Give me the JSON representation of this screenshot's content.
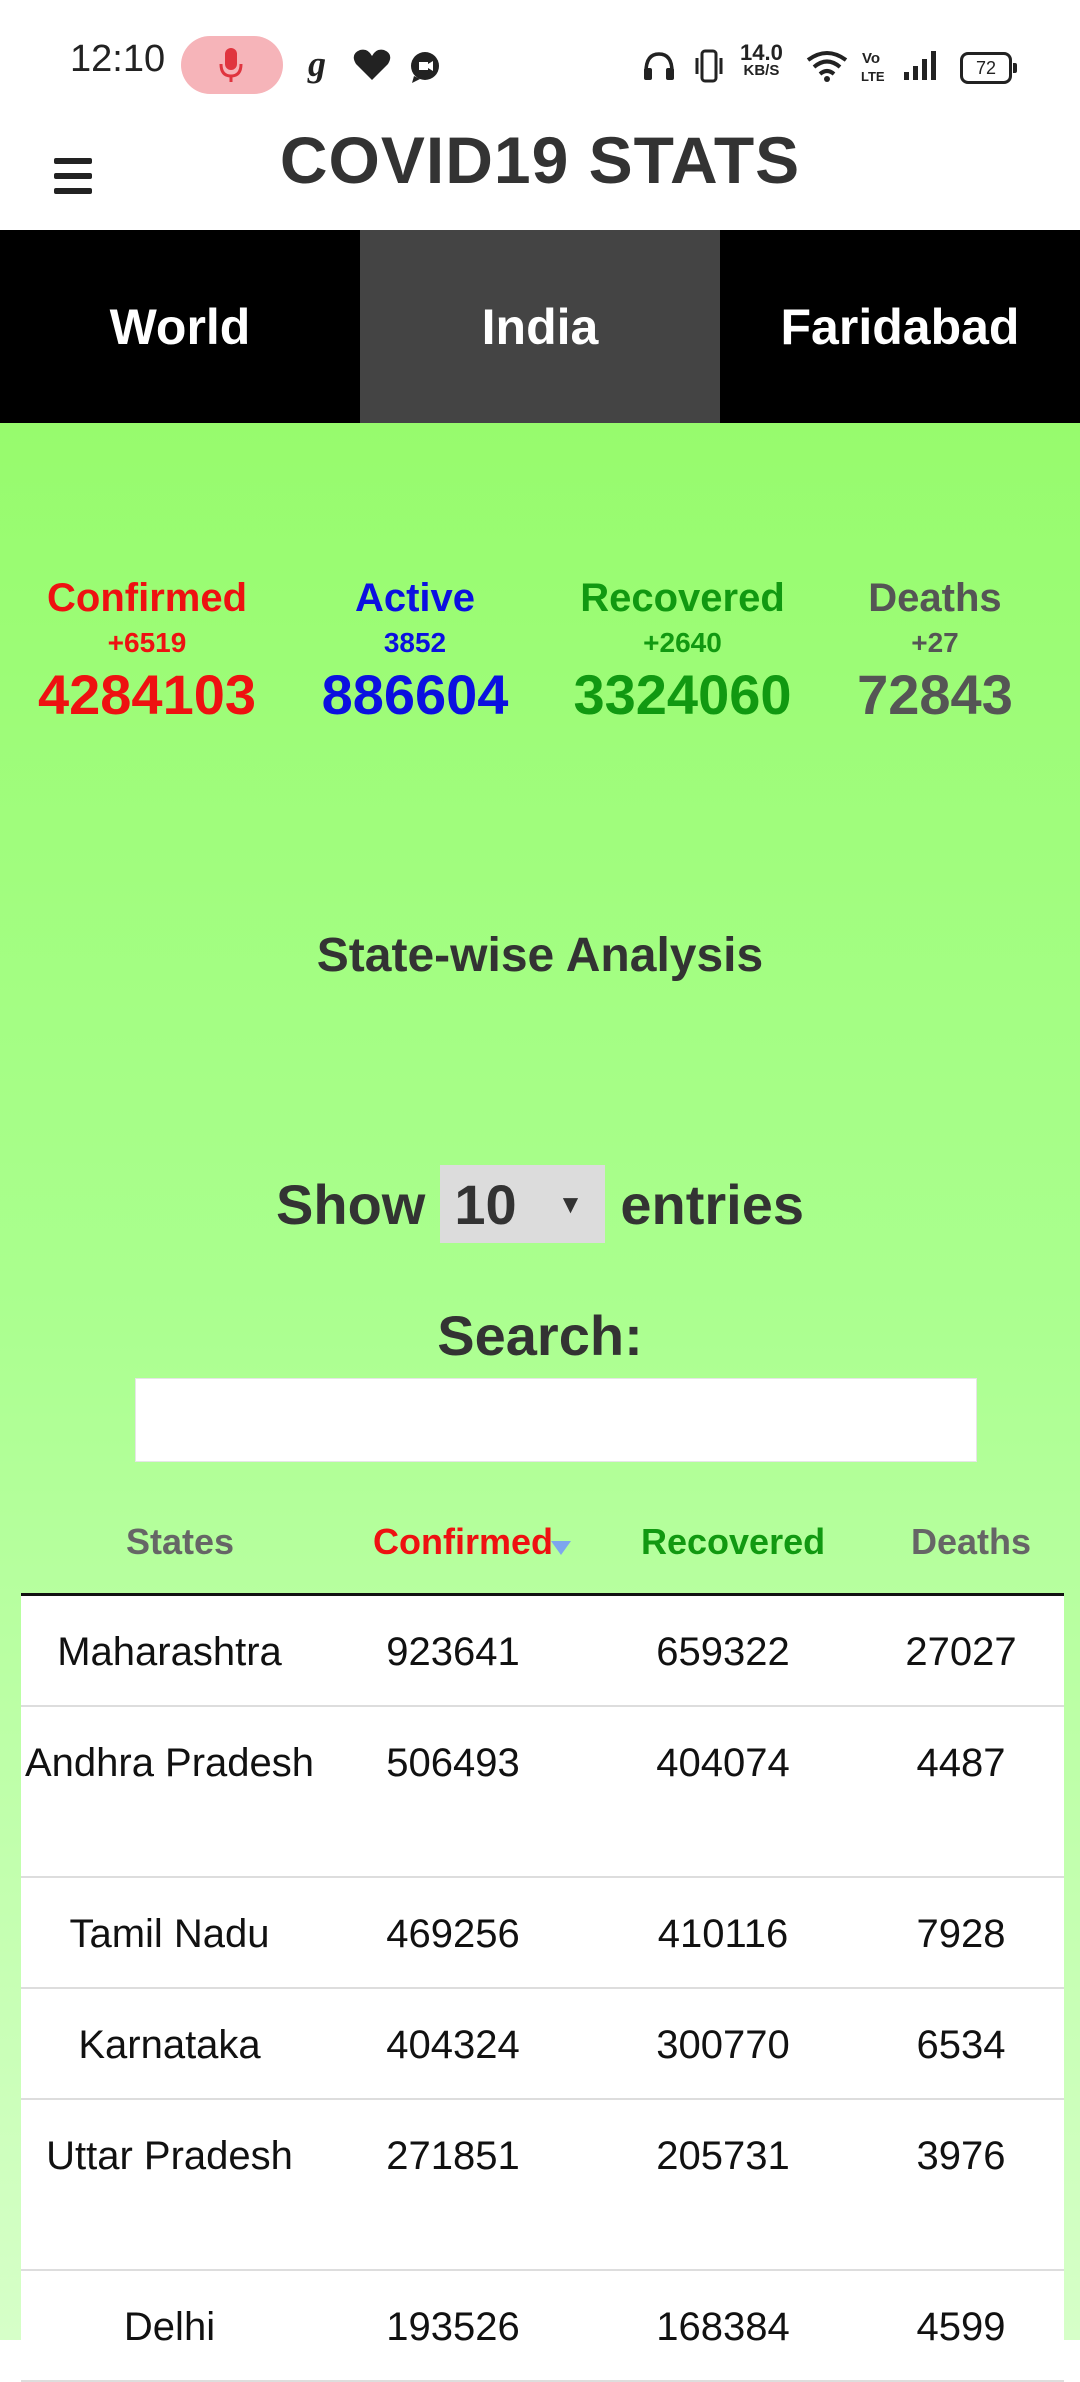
{
  "status_bar": {
    "time": "12:10",
    "speed_value": "14.0",
    "speed_unit": "KB/S",
    "battery": "72",
    "icons": [
      "mic-icon",
      "g-app-icon",
      "heart-icon",
      "chat-icon",
      "headphones-icon",
      "vibrate-icon",
      "wifi-icon",
      "volte-icon",
      "signal-icon",
      "battery-icon"
    ]
  },
  "header": {
    "title": "COVID19 STATS",
    "menu_icon": "hamburger-menu-icon"
  },
  "tabs": [
    {
      "label": "World",
      "active": false
    },
    {
      "label": "India",
      "active": true
    },
    {
      "label": "Faridabad",
      "active": false
    }
  ],
  "summary": [
    {
      "label": "Confirmed",
      "delta": "+6519",
      "value": "4284103",
      "color": "#ee1111"
    },
    {
      "label": "Active",
      "delta": "3852",
      "value": "886604",
      "color": "#0b10e0"
    },
    {
      "label": "Recovered",
      "delta": "+2640",
      "value": "3324060",
      "color": "#119911"
    },
    {
      "label": "Deaths",
      "delta": "+27",
      "value": "72843",
      "color": "#555555"
    }
  ],
  "analysis": {
    "title": "State-wise Analysis",
    "show_prefix": "Show",
    "show_value": "10",
    "show_suffix": "entries",
    "search_label": "Search:",
    "search_value": ""
  },
  "table": {
    "headers": [
      {
        "label": "States",
        "color": "#666666"
      },
      {
        "label": "Confirmed",
        "color": "#ee1111"
      },
      {
        "label": "Recovered",
        "color": "#119911"
      },
      {
        "label": "Deaths",
        "color": "#666666"
      }
    ],
    "rows": [
      {
        "state": "Maharashtra",
        "confirmed": "923641",
        "recovered": "659322",
        "deaths": "27027"
      },
      {
        "state": "Andhra Pradesh",
        "confirmed": "506493",
        "recovered": "404074",
        "deaths": "4487"
      },
      {
        "state": "Tamil Nadu",
        "confirmed": "469256",
        "recovered": "410116",
        "deaths": "7928"
      },
      {
        "state": "Karnataka",
        "confirmed": "404324",
        "recovered": "300770",
        "deaths": "6534"
      },
      {
        "state": "Uttar Pradesh",
        "confirmed": "271851",
        "recovered": "205731",
        "deaths": "3976"
      },
      {
        "state": "Delhi",
        "confirmed": "193526",
        "recovered": "168384",
        "deaths": "4599"
      }
    ]
  }
}
